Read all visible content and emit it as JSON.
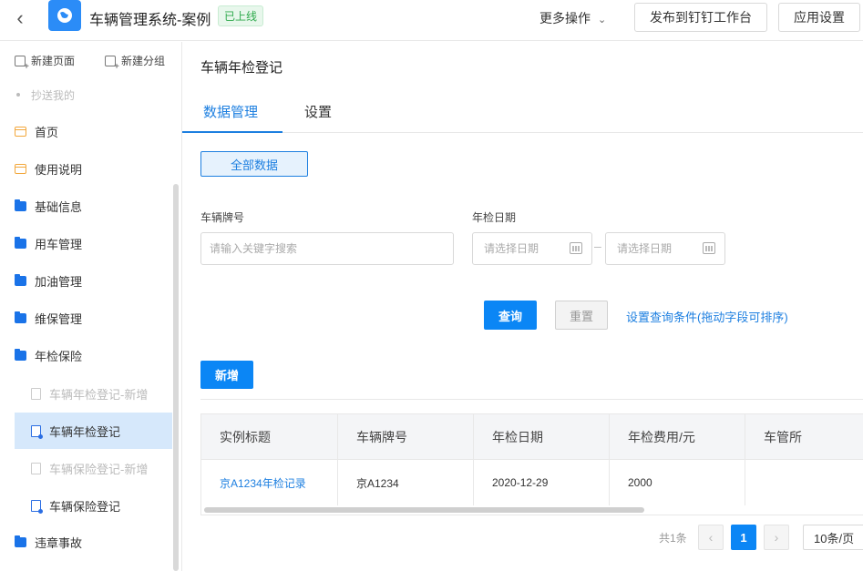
{
  "header": {
    "app_title": "车辆管理系统-案例",
    "status_badge": "已上线",
    "more_ops": "更多操作",
    "publish_button": "发布到钉钉工作台",
    "settings_button": "应用设置"
  },
  "sidebar": {
    "new_page": "新建页面",
    "new_group": "新建分组",
    "cc_me": "抄送我的",
    "items": [
      {
        "label": "首页",
        "icon": "page-icon"
      },
      {
        "label": "使用说明",
        "icon": "page-icon"
      },
      {
        "label": "基础信息",
        "icon": "folder-icon"
      },
      {
        "label": "用车管理",
        "icon": "folder-icon"
      },
      {
        "label": "加油管理",
        "icon": "folder-icon"
      },
      {
        "label": "维保管理",
        "icon": "folder-icon"
      },
      {
        "label": "年检保险",
        "icon": "folder-open-icon"
      }
    ],
    "sub_items": [
      {
        "label": "车辆年检登记-新增",
        "state": "disabled"
      },
      {
        "label": "车辆年检登记",
        "state": "active"
      },
      {
        "label": "车辆保险登记-新增",
        "state": "disabled"
      },
      {
        "label": "车辆保险登记",
        "state": "normal"
      }
    ],
    "last_item": {
      "label": "违章事故",
      "icon": "folder-icon"
    }
  },
  "main": {
    "page_title": "车辆年检登记",
    "tabs": [
      {
        "label": "数据管理",
        "active": true
      },
      {
        "label": "设置",
        "active": false
      }
    ],
    "all_data_button": "全部数据",
    "filters": {
      "plate_label": "车辆牌号",
      "plate_placeholder": "请输入关键字搜索",
      "date_label": "年检日期",
      "date_start_placeholder": "请选择日期",
      "date_end_placeholder": "请选择日期",
      "date_separator": "–"
    },
    "query_button": "查询",
    "reset_button": "重置",
    "query_settings_link": "设置查询条件(拖动字段可排序)",
    "add_button": "新增",
    "table": {
      "columns": [
        "实例标题",
        "车辆牌号",
        "年检日期",
        "年检费用/元",
        "车管所"
      ],
      "rows": [
        [
          "京A1234年检记录",
          "京A1234",
          "2020-12-29",
          "2000",
          ""
        ]
      ]
    },
    "pagination": {
      "total": "共1条",
      "current_page": "1",
      "page_size": "10条/页"
    }
  },
  "colors": {
    "accent": "#0b86f5",
    "link": "#1d7fe0",
    "badge_green": "#2faa4d",
    "active_nav_bg": "#d6e8fb"
  }
}
